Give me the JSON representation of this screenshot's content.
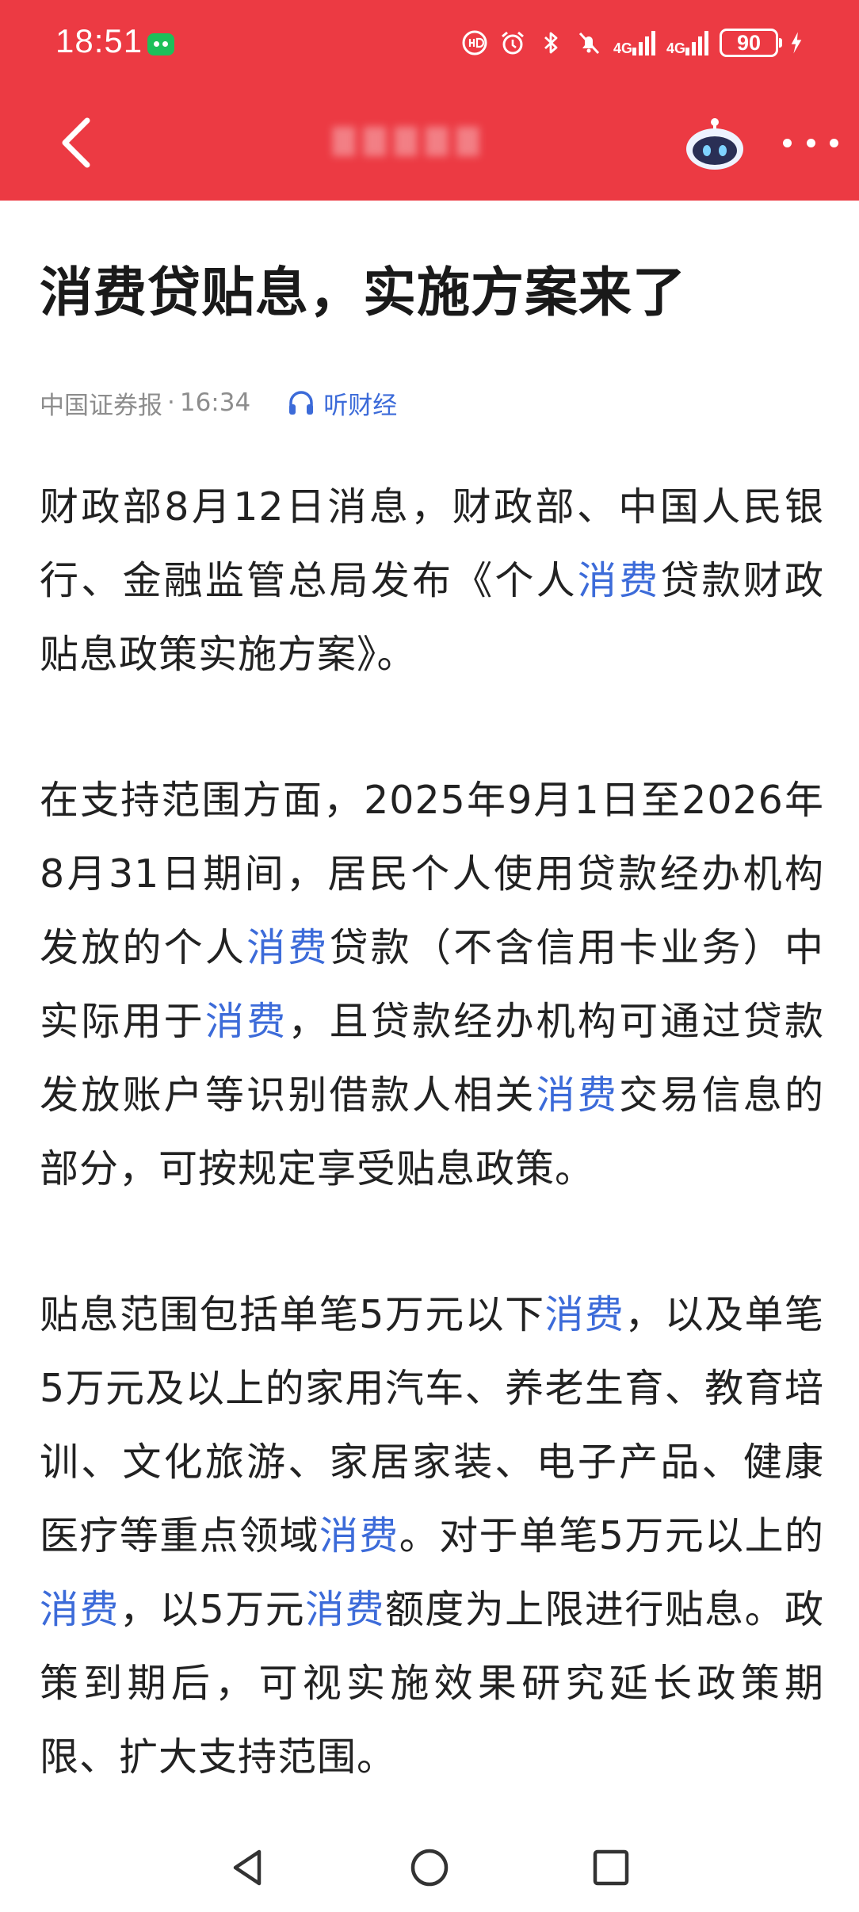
{
  "status_bar": {
    "time": "18:51",
    "net_label_1": "4G",
    "net_label_2": "4G",
    "battery": "90",
    "icons": [
      "wechat-icon",
      "hd-call-icon",
      "alarm-icon",
      "bluetooth-icon",
      "mute-icon",
      "signal-icon",
      "battery-icon",
      "charging-icon"
    ]
  },
  "nav": {
    "icons": [
      "back-arrow-icon",
      "robot-assistant-icon",
      "more-dots-icon"
    ],
    "accent_color": "#ec3a43"
  },
  "article": {
    "title": "消费贷贴息，实施方案来了",
    "source": "中国证券报",
    "separator": "·",
    "time": "16:34",
    "listen_label": "听财经",
    "highlight_color": "#3c6bd9",
    "paragraphs": [
      [
        {
          "t": "财政部8月12日消息，财政部、中国人民银行、金融监管总局发布《个人"
        },
        {
          "t": "消费",
          "hl": true
        },
        {
          "t": "贷款财政贴息政策实施方案》。"
        }
      ],
      [
        {
          "t": "在支持范围方面，2025年9月1日至2026年8月31日期间，居民个人使用贷款经办机构发放的个人"
        },
        {
          "t": "消费",
          "hl": true
        },
        {
          "t": "贷款（不含信用卡业务）中实际用于"
        },
        {
          "t": "消费",
          "hl": true
        },
        {
          "t": "，且贷款经办机构可通过贷款发放账户等识别借款人相关"
        },
        {
          "t": "消费",
          "hl": true
        },
        {
          "t": "交易信息的部分，可按规定享受贴息政策。"
        }
      ],
      [
        {
          "t": "贴息范围包括单笔5万元以下"
        },
        {
          "t": "消费",
          "hl": true
        },
        {
          "t": "，以及单笔5万元及以上的家用汽车、养老生育、教育培训、文化旅游、家居家装、电子产品、健康医疗等重点领域"
        },
        {
          "t": "消费",
          "hl": true
        },
        {
          "t": "。对于单笔5万元以上的"
        },
        {
          "t": "消费",
          "hl": true
        },
        {
          "t": "，以5万元"
        },
        {
          "t": "消费",
          "hl": true
        },
        {
          "t": "额度为上限进行贴息。政策到期后，可视实施效果研究延长政策期限、扩大支持范围。"
        }
      ]
    ]
  },
  "system_nav": {
    "icons": [
      "back-triangle-icon",
      "home-circle-icon",
      "recents-square-icon"
    ]
  }
}
